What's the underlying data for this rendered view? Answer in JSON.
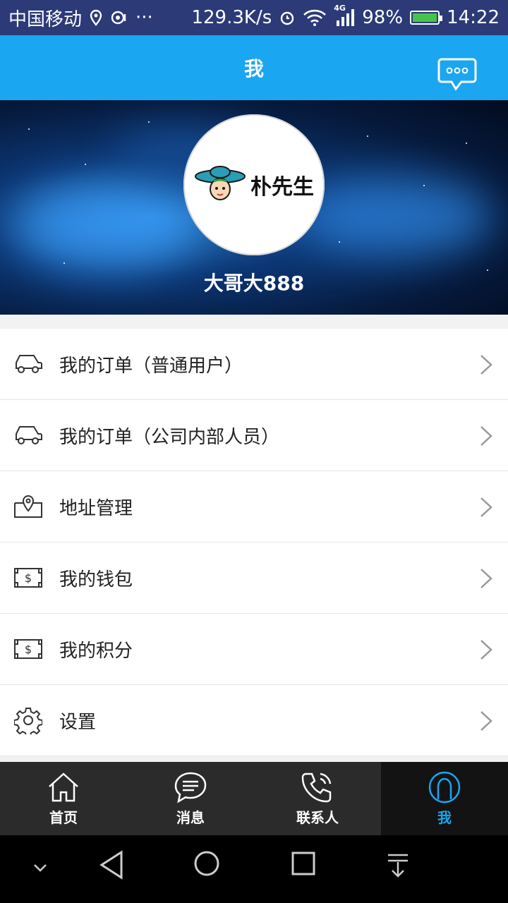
{
  "status": {
    "carrier": "中国移动",
    "speed": "129.3K/s",
    "network": "4G",
    "battery": "98%",
    "time": "14:22"
  },
  "header": {
    "title": "我"
  },
  "profile": {
    "username": "大哥大888",
    "logo_text": "朴先生"
  },
  "menu": {
    "items": [
      {
        "label": "我的订单（普通用户）",
        "icon": "car-icon"
      },
      {
        "label": "我的订单（公司内部人员）",
        "icon": "car-icon"
      },
      {
        "label": "地址管理",
        "icon": "location-icon"
      },
      {
        "label": "我的钱包",
        "icon": "dollar-bill-icon"
      },
      {
        "label": "我的积分",
        "icon": "dollar-bill-icon"
      },
      {
        "label": "设置",
        "icon": "gear-icon"
      }
    ]
  },
  "tabs": [
    {
      "label": "首页",
      "icon": "home-icon"
    },
    {
      "label": "消息",
      "icon": "message-icon"
    },
    {
      "label": "联系人",
      "icon": "phone-icon"
    },
    {
      "label": "我",
      "icon": "user-icon",
      "active": true
    }
  ],
  "colors": {
    "accent": "#1aa6f1",
    "tabbar": "#2b2b2b"
  }
}
